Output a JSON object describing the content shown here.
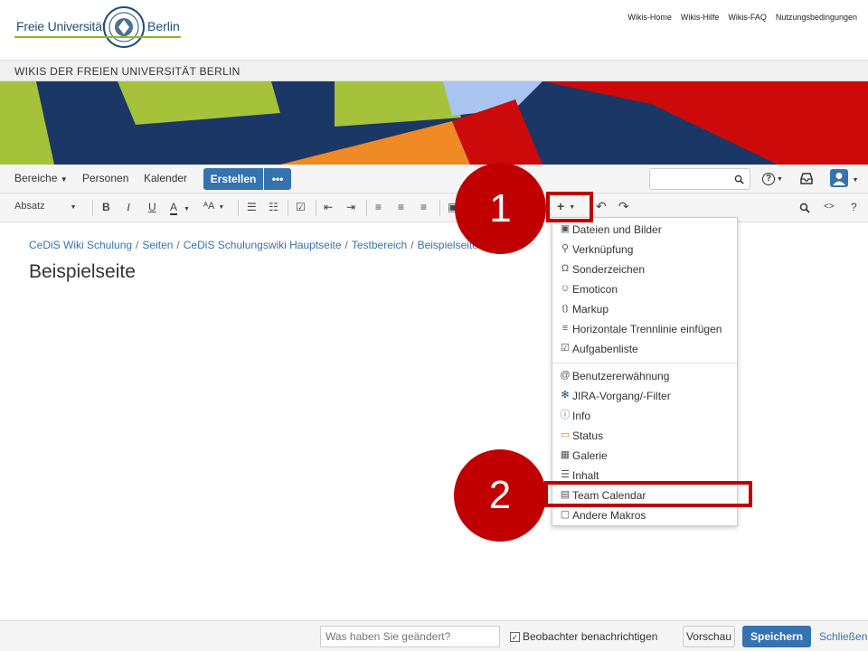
{
  "header": {
    "logo_left": "Freie Universität",
    "logo_right": "Berlin",
    "links": [
      "Wikis-Home",
      "Wikis-Hilfe",
      "Wikis-FAQ",
      "Nutzungsbedingungen"
    ],
    "wiki_title": "WIKIS DER FREIEN UNIVERSITÄT BERLIN"
  },
  "nav": {
    "spaces": "Bereiche",
    "people": "Personen",
    "calendar": "Kalender",
    "create": "Erstellen",
    "more": "•••",
    "help_icon": "?"
  },
  "toolbar": {
    "paragraph": "Absatz",
    "bold": "B",
    "italic": "I",
    "underline": "U",
    "text_color": "A",
    "insert": "+"
  },
  "breadcrumb": [
    "CeDiS Wiki Schulung",
    "Seiten",
    "CeDiS Schulungswiki Hauptseite",
    "Testbereich",
    "Beispielseite"
  ],
  "page_title": "Beispielseite",
  "insert_menu": {
    "items": [
      {
        "icon": "image-file-icon",
        "glyph": "▣",
        "label": "Dateien und Bilder"
      },
      {
        "icon": "link-icon",
        "glyph": "⚲",
        "label": "Verknüpfung"
      },
      {
        "icon": "omega-icon",
        "glyph": "Ω",
        "label": "Sonderzeichen"
      },
      {
        "icon": "smiley-icon",
        "glyph": "☺",
        "label": "Emoticon"
      },
      {
        "icon": "markup-icon",
        "glyph": "⦅⦆",
        "label": "Markup"
      },
      {
        "icon": "horizontal-rule-icon",
        "glyph": "≡",
        "label": "Horizontale Trennlinie einfügen"
      },
      {
        "icon": "task-list-icon",
        "glyph": "☑",
        "label": "Aufgabenliste"
      },
      {
        "icon": "at-icon",
        "glyph": "@",
        "label": "Benutzererwähnung"
      },
      {
        "icon": "jira-icon",
        "glyph": "✻",
        "label": "JIRA-Vorgang/-Filter"
      },
      {
        "icon": "info-icon",
        "glyph": "ⓘ",
        "label": "Info"
      },
      {
        "icon": "status-icon",
        "glyph": "▭",
        "label": "Status"
      },
      {
        "icon": "gallery-icon",
        "glyph": "▦",
        "label": "Galerie"
      },
      {
        "icon": "toc-icon",
        "glyph": "☰",
        "label": "Inhalt"
      },
      {
        "icon": "calendar-icon",
        "glyph": "▤",
        "label": "Team Calendar"
      },
      {
        "icon": "macro-icon",
        "glyph": "▢",
        "label": "Andere Makros"
      }
    ]
  },
  "annotations": {
    "step1": "1",
    "step2": "2"
  },
  "footer": {
    "change_placeholder": "Was haben Sie geändert?",
    "watch_label": "Beobachter benachrichtigen",
    "watch_checked": "✓",
    "preview": "Vorschau",
    "save": "Speichern",
    "close": "Schließen"
  },
  "colors": {
    "accent": "#3572b0",
    "annotation": "#c00000",
    "fu_green": "#8cb825",
    "fu_blue": "#1f4e79"
  }
}
